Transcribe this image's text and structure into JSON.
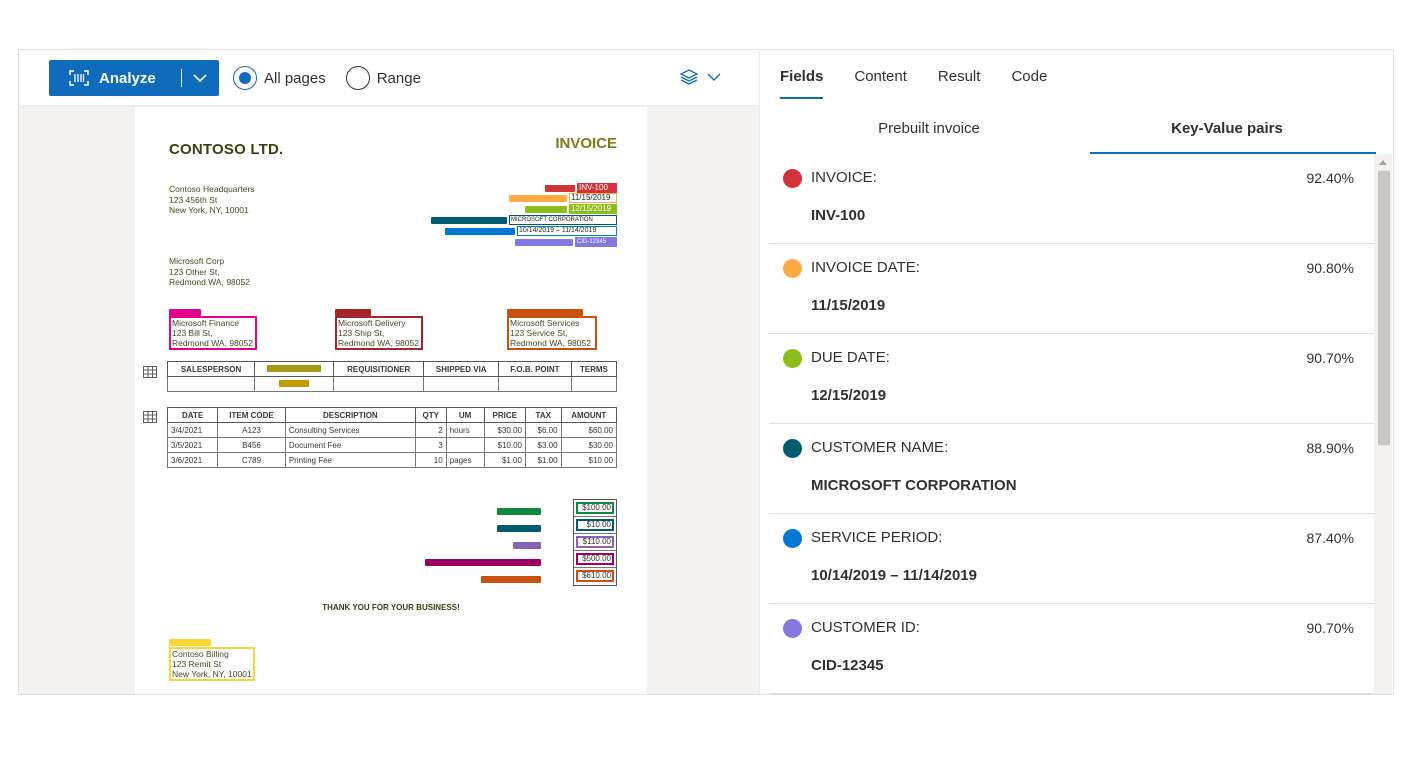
{
  "toolbar": {
    "analyze_label": "Analyze",
    "radios": [
      {
        "label": "All pages",
        "selected": true
      },
      {
        "label": "Range",
        "selected": false
      }
    ],
    "layers_icon": "layers-icon"
  },
  "colors": {
    "accent": "#0f6cbd",
    "invoice": "#d13438",
    "invoice_date": "#ffaa44",
    "due_date": "#8cbd18",
    "customer_name": "#005b70",
    "service_period": "#0078d4",
    "customer_id": "#8378de"
  },
  "document": {
    "company": "CONTOSO LTD.",
    "title": "INVOICE",
    "hq": [
      "Contoso Headquarters",
      "123 456th St",
      "New York, NY, 10001"
    ],
    "customer": [
      "Microsoft Corp",
      "123 Other St,",
      "Redmond WA, 98052"
    ],
    "header_values": {
      "invoice_id": "INV-100",
      "invoice_date": "11/15/2019",
      "due_date": "12/15/2019",
      "customer_name": "MICROSOFT CORPORATION",
      "service_period": "10/14/2019 – 11/14/2019",
      "customer_id": "CID-12345"
    },
    "bill_to": [
      "Microsoft Finance",
      "123 Bill St,",
      "Redmond WA, 98052"
    ],
    "ship_to": [
      "Microsoft Delivery",
      "123 Ship St,",
      "Redmond WA, 98052"
    ],
    "service_address": [
      "Microsoft Services",
      "123 Service St,",
      "Redmond WA, 98052"
    ],
    "sales_headers": [
      "SALESPERSON",
      "",
      "REQUISITIONER",
      "SHIPPED VIA",
      "F.O.B. POINT",
      "TERMS"
    ],
    "item_headers": [
      "DATE",
      "ITEM CODE",
      "DESCRIPTION",
      "QTY",
      "UM",
      "PRICE",
      "TAX",
      "AMOUNT"
    ],
    "items": [
      [
        "3/4/2021",
        "A123",
        "Consulting Services",
        "2",
        "hours",
        "$30.00",
        "$6.00",
        "$60.00"
      ],
      [
        "3/5/2021",
        "B456",
        "Document Fee",
        "3",
        "",
        "$10.00",
        "$3.00",
        "$30.00"
      ],
      [
        "3/6/2021",
        "C789",
        "Printing Fee",
        "10",
        "pages",
        "$1.00",
        "$1.00",
        "$10.00"
      ]
    ],
    "totals": [
      "$100.00",
      "$10.00",
      "$110.00",
      "$500.00",
      "$610.00"
    ],
    "thanks": "THANK YOU FOR YOUR BUSINESS!",
    "remit_to": [
      "Contoso Billing",
      "123 Remit St",
      "New York, NY, 10001"
    ]
  },
  "panel": {
    "tabs": [
      "Fields",
      "Content",
      "Result",
      "Code"
    ],
    "subtabs": [
      "Prebuilt invoice",
      "Key-Value pairs"
    ],
    "fields": [
      {
        "key": "INVOICE:",
        "confidence": "92.40%",
        "value": "INV-100",
        "color": "#d13438"
      },
      {
        "key": "INVOICE DATE:",
        "confidence": "90.80%",
        "value": "11/15/2019",
        "color": "#ffaa44"
      },
      {
        "key": "DUE DATE:",
        "confidence": "90.70%",
        "value": "12/15/2019",
        "color": "#8cbd18"
      },
      {
        "key": "CUSTOMER NAME:",
        "confidence": "88.90%",
        "value": "MICROSOFT CORPORATION",
        "color": "#005b70"
      },
      {
        "key": "SERVICE PERIOD:",
        "confidence": "87.40%",
        "value": "10/14/2019 – 11/14/2019",
        "color": "#0078d4"
      },
      {
        "key": "CUSTOMER ID:",
        "confidence": "90.70%",
        "value": "CID-12345",
        "color": "#8378de"
      }
    ]
  }
}
